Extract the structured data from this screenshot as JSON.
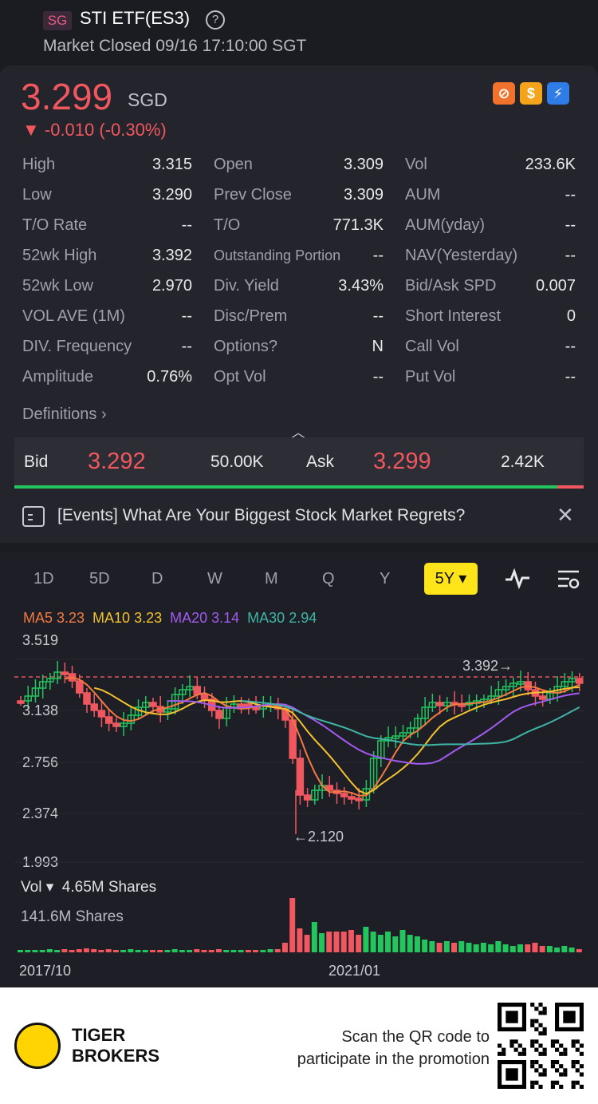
{
  "header": {
    "market_badge": "SG",
    "title": "STI ETF(ES3)",
    "status": "Market Closed 09/16 17:10:00 SGT"
  },
  "quote": {
    "price": "3.299",
    "currency": "SGD",
    "change": "▼ -0.010 (-0.30%)",
    "colors": {
      "down": "#f0575e",
      "up": "#22c55e"
    }
  },
  "stats": [
    [
      {
        "label": "High",
        "value": "3.315"
      },
      {
        "label": "Open",
        "value": "3.309"
      },
      {
        "label": "Vol",
        "value": "233.6K"
      }
    ],
    [
      {
        "label": "Low",
        "value": "3.290"
      },
      {
        "label": "Prev Close",
        "value": "3.309"
      },
      {
        "label": "AUM",
        "value": "--"
      }
    ],
    [
      {
        "label": "T/O Rate",
        "value": "--"
      },
      {
        "label": "T/O",
        "value": "771.3K"
      },
      {
        "label": "AUM(yday)",
        "value": "--"
      }
    ],
    [
      {
        "label": "52wk High",
        "value": "3.392"
      },
      {
        "label": "Outstanding Portion",
        "value": "--"
      },
      {
        "label": "NAV(Yesterday)",
        "value": "--"
      }
    ],
    [
      {
        "label": "52wk Low",
        "value": "2.970"
      },
      {
        "label": "Div. Yield",
        "value": "3.43%"
      },
      {
        "label": "Bid/Ask SPD",
        "value": "0.007"
      }
    ],
    [
      {
        "label": "VOL AVE (1M)",
        "value": "--"
      },
      {
        "label": "Disc/Prem",
        "value": "--"
      },
      {
        "label": "Short Interest",
        "value": "0"
      }
    ],
    [
      {
        "label": "DIV. Frequency",
        "value": "--"
      },
      {
        "label": "Options?",
        "value": "N"
      },
      {
        "label": "Call Vol",
        "value": "--"
      }
    ],
    [
      {
        "label": "Amplitude",
        "value": "0.76%"
      },
      {
        "label": "Opt Vol",
        "value": "--"
      },
      {
        "label": "Put Vol",
        "value": "--"
      }
    ]
  ],
  "definitions_label": "Definitions",
  "bidask": {
    "bid_label": "Bid",
    "bid_price": "3.292",
    "bid_qty": "50.00K",
    "ask_label": "Ask",
    "ask_price": "3.299",
    "ask_qty": "2.42K",
    "bid_fraction": 0.954
  },
  "event_banner": "[Events] What Are Your Biggest Stock Market Regrets?",
  "period_tabs": [
    "1D",
    "5D",
    "D",
    "W",
    "M",
    "Q",
    "Y"
  ],
  "active_period": "5Y",
  "ma": [
    {
      "label": "MA5 3.23",
      "color": "#f37a3f"
    },
    {
      "label": "MA10 3.23",
      "color": "#f2c12e"
    },
    {
      "label": "MA20 3.14",
      "color": "#a35af0"
    },
    {
      "label": "MA30 2.94",
      "color": "#3fb5a5"
    }
  ],
  "price_axis": [
    "3.519",
    "3.138",
    "2.756",
    "2.374",
    "1.993"
  ],
  "annotations": {
    "high": "3.392",
    "low": "←2.120"
  },
  "volume": {
    "label": "Vol",
    "current": "4.65M Shares",
    "max": "141.6M Shares"
  },
  "dates": [
    "2017/10",
    "2021/01"
  ],
  "footer": {
    "brand_line1": "TIGER",
    "brand_line2": "BROKERS",
    "promo_line1": "Scan the QR code to",
    "promo_line2": "participate in the promotion"
  }
}
